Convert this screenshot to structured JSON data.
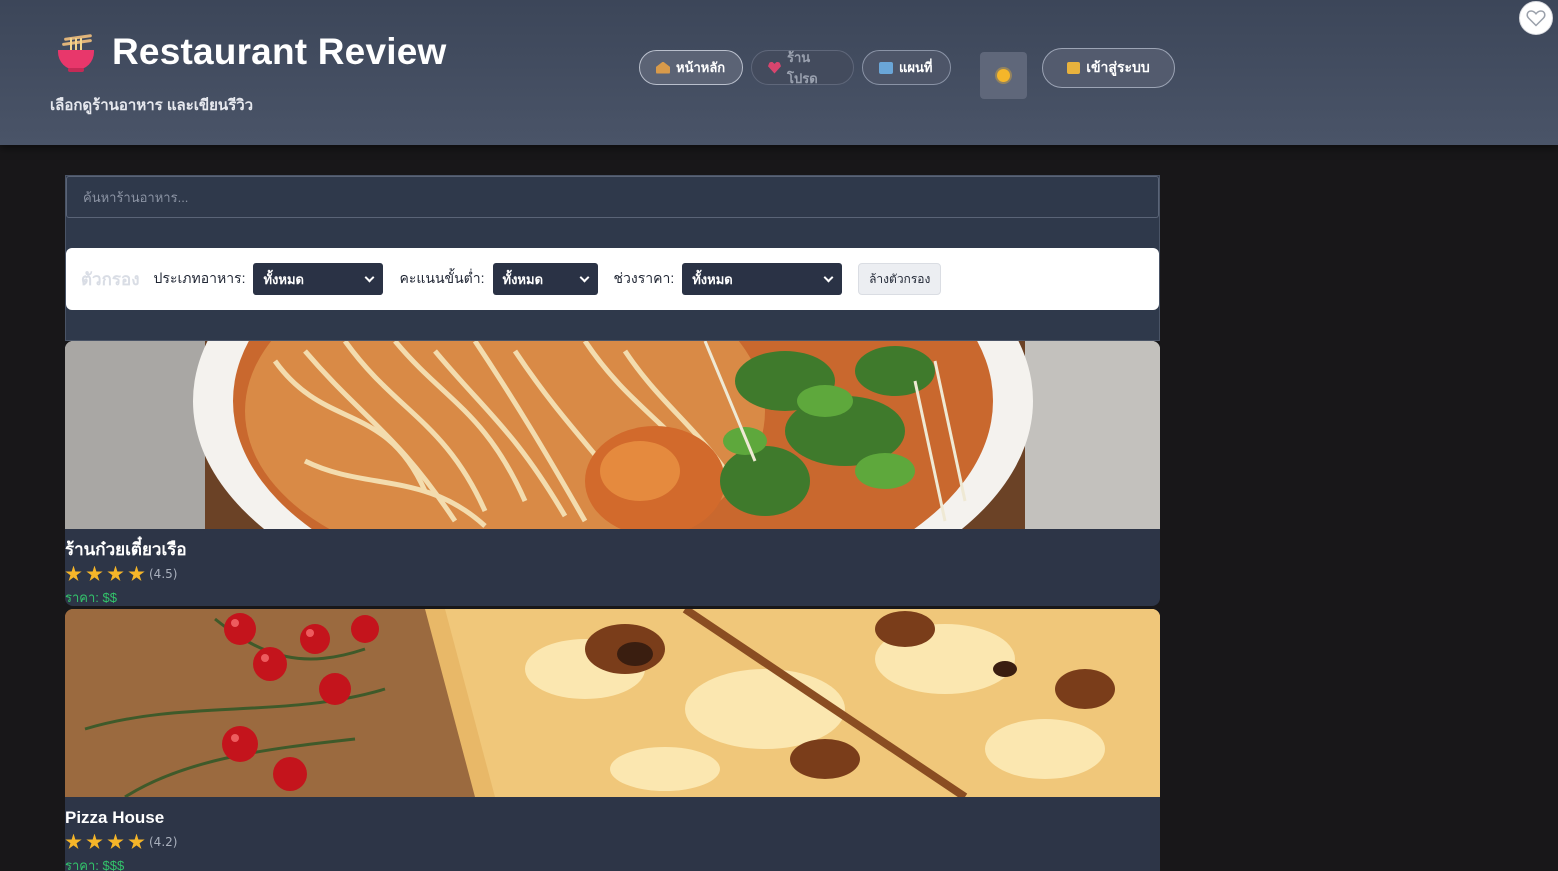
{
  "header": {
    "title": "Restaurant Review",
    "subtitle": "เลือกดูร้านอาหาร และเขียนรีวิว",
    "nav": [
      {
        "label": "หน้าหลัก",
        "icon": "house-icon"
      },
      {
        "label": "ร้านโปรด",
        "icon": "heart-icon"
      },
      {
        "label": "แผนที่",
        "icon": "map-icon"
      }
    ],
    "theme_icon": "sun-icon",
    "login_label": "เข้าสู่ระบบ",
    "login_icon": "lock-icon"
  },
  "search": {
    "placeholder": "ค้นหาร้านอาหาร..."
  },
  "filters": {
    "title": "ตัวกรอง",
    "food_type_label": "ประเภทอาหาร:",
    "food_type_value": "ทั้งหมด",
    "min_rating_label": "คะแนนขั้นต่ำ:",
    "min_rating_value": "ทั้งหมด",
    "price_range_label": "ช่วงราคา:",
    "price_range_value": "ทั้งหมด",
    "clear_label": "ล้างตัวกรอง"
  },
  "restaurants": [
    {
      "name": "ร้านก๋วยเตี๋ยวเรือ",
      "stars": 4,
      "rating_text": "(4.5)",
      "price": "ราคา: $$"
    },
    {
      "name": "Pizza House",
      "stars": 4,
      "rating_text": "(4.2)",
      "price": "ราคา: $$$"
    }
  ],
  "colors": {
    "accent_star": "#f5b529",
    "price_green": "#33c46b",
    "header_bg": "#3c4659"
  }
}
